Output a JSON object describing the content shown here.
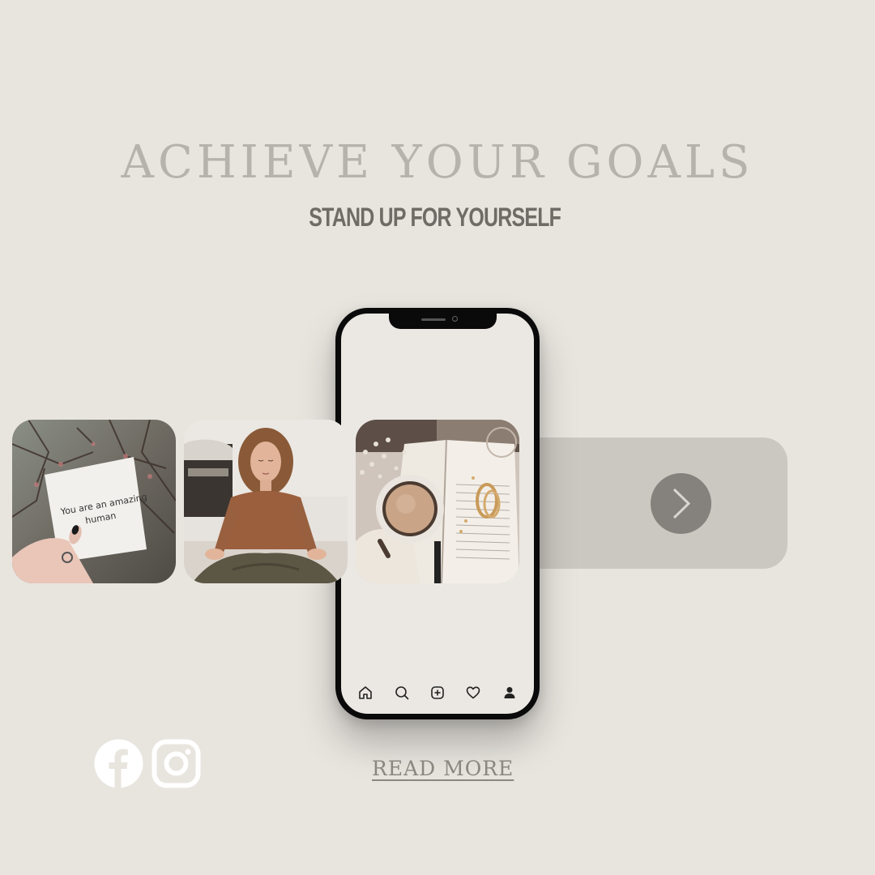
{
  "header": {
    "title": "ACHIEVE YOUR GOALS",
    "subtitle": "STAND UP FOR YOURSELF"
  },
  "gallery": {
    "tiles": [
      {
        "name": "note-photo",
        "caption_line1": "You are an amazing",
        "caption_line2": "human"
      },
      {
        "name": "meditation-photo"
      },
      {
        "name": "coffee-book-photo"
      }
    ]
  },
  "phone": {
    "nav_icons": [
      "home-icon",
      "search-icon",
      "add-post-icon",
      "heart-icon",
      "profile-icon"
    ]
  },
  "next": {
    "icon": "chevron-right-icon"
  },
  "social": {
    "icons": [
      "facebook-icon",
      "instagram-icon"
    ]
  },
  "cta": {
    "read_more": "READ MORE "
  },
  "colors": {
    "background": "#e8e5df",
    "title": "#b6b2ac",
    "subtitle": "#6f6b66",
    "panel": "#cbc7c1",
    "button": "#85817c"
  }
}
